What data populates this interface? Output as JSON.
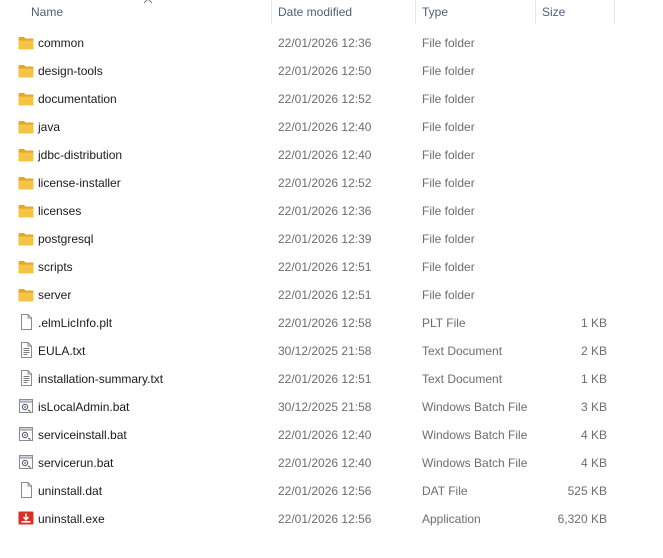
{
  "columns": {
    "name": "Name",
    "date_modified": "Date modified",
    "type": "Type",
    "size": "Size"
  },
  "colors": {
    "folder": "#f6c445",
    "folder_dark": "#e0a92c",
    "header_text": "#4c607a",
    "secondary_text": "#6d6d6d"
  },
  "files": [
    {
      "name": "common",
      "date": "22/01/2026 12:36",
      "type": "File folder",
      "size": "",
      "icon": "folder-icon"
    },
    {
      "name": "design-tools",
      "date": "22/01/2026 12:50",
      "type": "File folder",
      "size": "",
      "icon": "folder-icon"
    },
    {
      "name": "documentation",
      "date": "22/01/2026 12:52",
      "type": "File folder",
      "size": "",
      "icon": "folder-icon"
    },
    {
      "name": "java",
      "date": "22/01/2026 12:40",
      "type": "File folder",
      "size": "",
      "icon": "folder-icon"
    },
    {
      "name": "jdbc-distribution",
      "date": "22/01/2026 12:40",
      "type": "File folder",
      "size": "",
      "icon": "folder-icon"
    },
    {
      "name": "license-installer",
      "date": "22/01/2026 12:52",
      "type": "File folder",
      "size": "",
      "icon": "folder-icon"
    },
    {
      "name": "licenses",
      "date": "22/01/2026 12:36",
      "type": "File folder",
      "size": "",
      "icon": "folder-icon"
    },
    {
      "name": "postgresql",
      "date": "22/01/2026 12:39",
      "type": "File folder",
      "size": "",
      "icon": "folder-icon"
    },
    {
      "name": "scripts",
      "date": "22/01/2026 12:51",
      "type": "File folder",
      "size": "",
      "icon": "folder-icon"
    },
    {
      "name": "server",
      "date": "22/01/2026 12:51",
      "type": "File folder",
      "size": "",
      "icon": "folder-icon"
    },
    {
      "name": ".elmLicInfo.plt",
      "date": "22/01/2026 12:58",
      "type": "PLT File",
      "size": "1 KB",
      "icon": "blank-file-icon"
    },
    {
      "name": "EULA.txt",
      "date": "30/12/2025 21:58",
      "type": "Text Document",
      "size": "2 KB",
      "icon": "text-file-icon"
    },
    {
      "name": "installation-summary.txt",
      "date": "22/01/2026 12:51",
      "type": "Text Document",
      "size": "1 KB",
      "icon": "text-file-icon"
    },
    {
      "name": "isLocalAdmin.bat",
      "date": "30/12/2025 21:58",
      "type": "Windows Batch File",
      "size": "3 KB",
      "icon": "batch-file-icon"
    },
    {
      "name": "serviceinstall.bat",
      "date": "22/01/2026 12:40",
      "type": "Windows Batch File",
      "size": "4 KB",
      "icon": "batch-file-icon"
    },
    {
      "name": "servicerun.bat",
      "date": "22/01/2026 12:40",
      "type": "Windows Batch File",
      "size": "4 KB",
      "icon": "batch-file-icon"
    },
    {
      "name": "uninstall.dat",
      "date": "22/01/2026 12:56",
      "type": "DAT File",
      "size": "525 KB",
      "icon": "blank-file-icon"
    },
    {
      "name": "uninstall.exe",
      "date": "22/01/2026 12:56",
      "type": "Application",
      "size": "6,320 KB",
      "icon": "installer-app-icon"
    }
  ]
}
